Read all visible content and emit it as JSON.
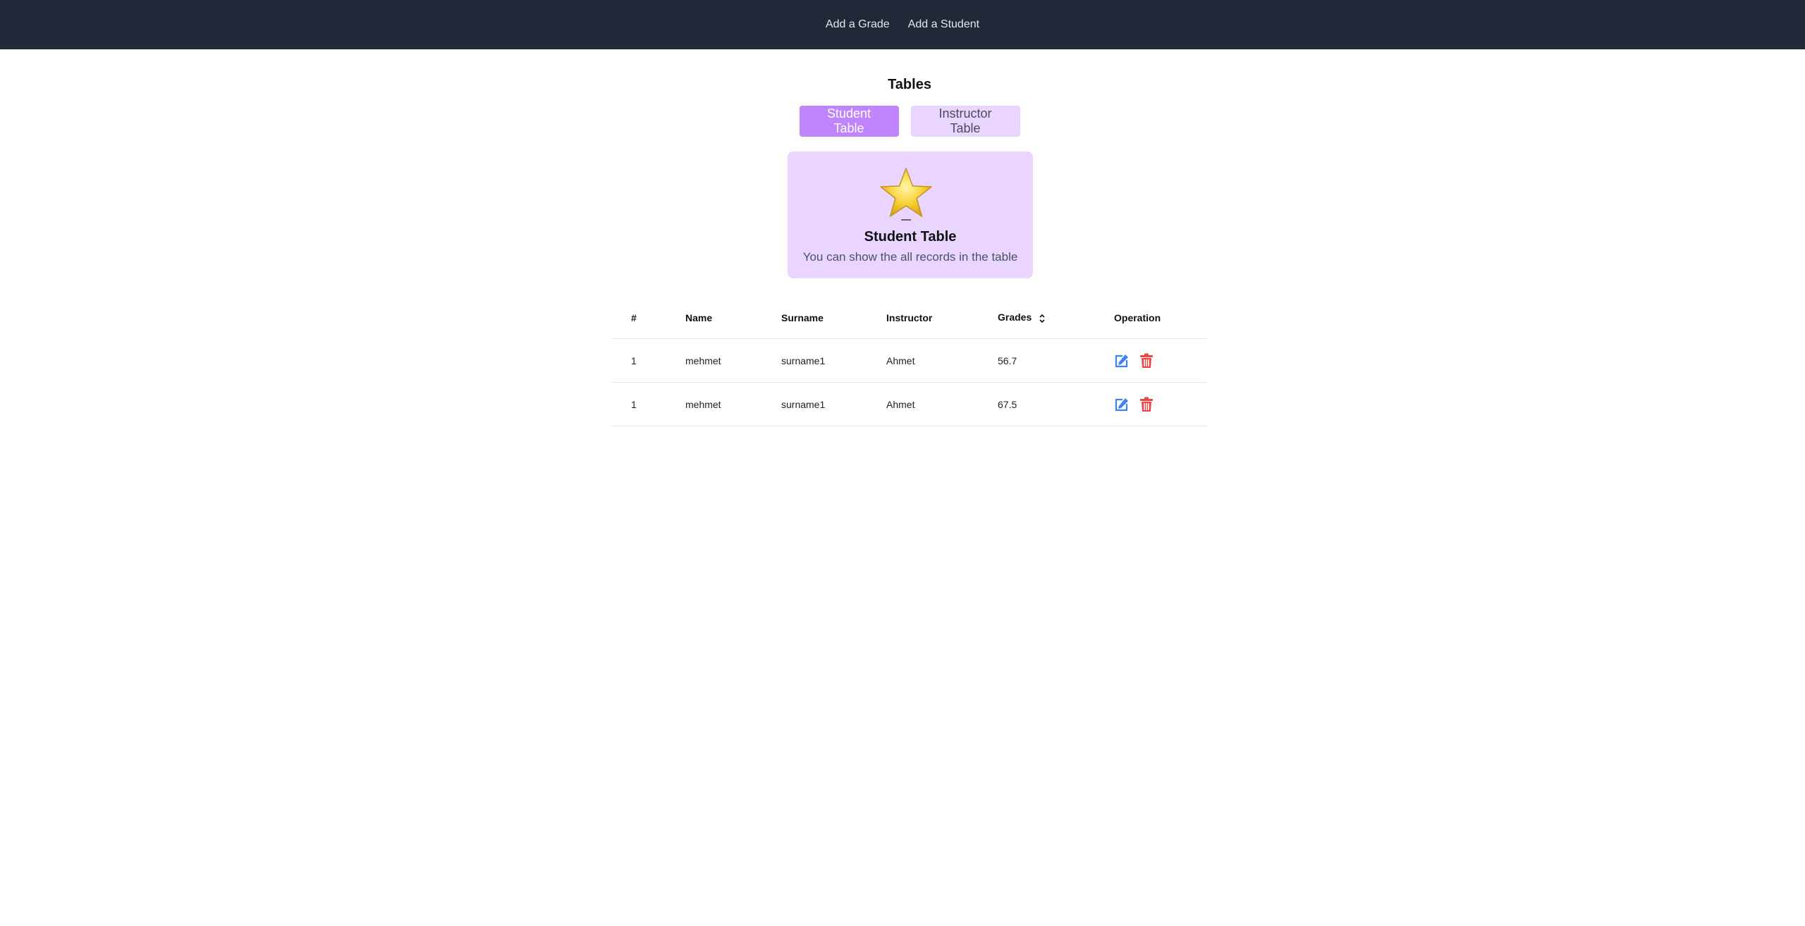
{
  "nav": {
    "items": [
      {
        "label": "Add a Grade"
      },
      {
        "label": "Add a Student"
      }
    ]
  },
  "page": {
    "title": "Tables"
  },
  "tabs": [
    {
      "label": "Student Table",
      "active": true
    },
    {
      "label": "Instructor Table",
      "active": false
    }
  ],
  "card": {
    "icon": "star-icon",
    "title": "Student Table",
    "description": "You can show the all records in the table"
  },
  "table": {
    "headers": [
      "#",
      "Name",
      "Surname",
      "Instructor",
      "Grades",
      "Operation"
    ],
    "sort_icon": "sort-icon",
    "rows": [
      {
        "id": "1",
        "name": "mehmet",
        "surname": "surname1",
        "instructor": "Ahmet",
        "grade": "56.7"
      },
      {
        "id": "1",
        "name": "mehmet",
        "surname": "surname1",
        "instructor": "Ahmet",
        "grade": "67.5"
      }
    ],
    "operation_icons": [
      "edit-icon",
      "trash-icon"
    ]
  },
  "colors": {
    "nav_bg": "#1f2937",
    "tab_active": "#c084fc",
    "tab_inactive": "#e9d5ff",
    "card_bg": "#e9d5ff",
    "edit_icon": "#3b82f6",
    "trash_icon": "#ef4444"
  }
}
